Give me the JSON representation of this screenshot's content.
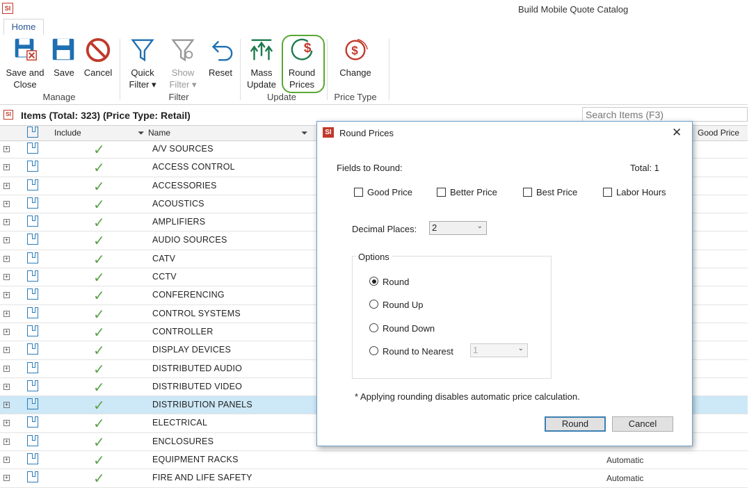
{
  "window": {
    "logo": "SI",
    "title": "Build Mobile Quote Catalog"
  },
  "tabs": [
    {
      "label": "Home"
    }
  ],
  "ribbon": {
    "groups": [
      {
        "label": "Manage"
      },
      {
        "label": "Filter"
      },
      {
        "label": "Update"
      },
      {
        "label": "Price Type"
      }
    ],
    "buttons": {
      "save_close": {
        "line1": "Save and",
        "line2": "Close",
        "icon": "save-close-icon"
      },
      "save": {
        "line1": "Save",
        "line2": "",
        "icon": "save-icon"
      },
      "cancel": {
        "line1": "Cancel",
        "line2": "",
        "icon": "cancel-icon"
      },
      "quick_filter": {
        "line1": "Quick",
        "line2": "Filter ▾",
        "icon": "filter-icon"
      },
      "show_filter": {
        "line1": "Show",
        "line2": "Filter ▾",
        "icon": "show-filter-icon"
      },
      "reset": {
        "line1": "Reset",
        "line2": "",
        "icon": "undo-icon"
      },
      "mass_update": {
        "line1": "Mass",
        "line2": "Update",
        "icon": "mass-update-icon"
      },
      "round_prices": {
        "line1": "Round",
        "line2": "Prices",
        "icon": "round-dollar-icon"
      },
      "change": {
        "line1": "Change",
        "line2": "",
        "icon": "change-price-icon"
      }
    }
  },
  "items": {
    "title": "Items (Total: 323) (Price Type: Retail)",
    "search_placeholder": "Search Items (F3)",
    "columns": {
      "include": "Include",
      "name": "Name",
      "good_price": "Good Price"
    },
    "rows": [
      {
        "name": "A/V SOURCES"
      },
      {
        "name": "ACCESS CONTROL"
      },
      {
        "name": "ACCESSORIES"
      },
      {
        "name": "ACOUSTICS"
      },
      {
        "name": "AMPLIFIERS"
      },
      {
        "name": "AUDIO SOURCES"
      },
      {
        "name": "CATV"
      },
      {
        "name": "CCTV"
      },
      {
        "name": "CONFERENCING"
      },
      {
        "name": "CONTROL SYSTEMS"
      },
      {
        "name": "CONTROLLER"
      },
      {
        "name": "DISPLAY DEVICES"
      },
      {
        "name": "DISTRIBUTED AUDIO"
      },
      {
        "name": "DISTRIBUTED VIDEO"
      },
      {
        "name": "DISTRIBUTION PANELS",
        "selected": true
      },
      {
        "name": "ELECTRICAL"
      },
      {
        "name": "ENCLOSURES"
      },
      {
        "name": "EQUIPMENT RACKS",
        "calc": "Automatic"
      },
      {
        "name": "FIRE AND LIFE SAFETY",
        "calc": "Automatic"
      }
    ]
  },
  "dialog": {
    "logo": "SI",
    "title": "Round Prices",
    "close": "✕",
    "fields_label": "Fields to Round:",
    "total": "Total: 1",
    "checkboxes": [
      {
        "label": "Good Price",
        "checked": false
      },
      {
        "label": "Better Price",
        "checked": false
      },
      {
        "label": "Best Price",
        "checked": false
      },
      {
        "label": "Labor Hours",
        "checked": false
      }
    ],
    "decimal_label": "Decimal Places:",
    "decimal_value": "2",
    "options_label": "Options",
    "options": [
      {
        "label": "Round",
        "selected": true
      },
      {
        "label": "Round Up",
        "selected": false
      },
      {
        "label": "Round Down",
        "selected": false
      },
      {
        "label": "Round to Nearest",
        "selected": false
      }
    ],
    "nearest_value": "1",
    "note": "* Applying rounding disables automatic price calculation.",
    "round_button": "Round",
    "cancel_button": "Cancel"
  }
}
